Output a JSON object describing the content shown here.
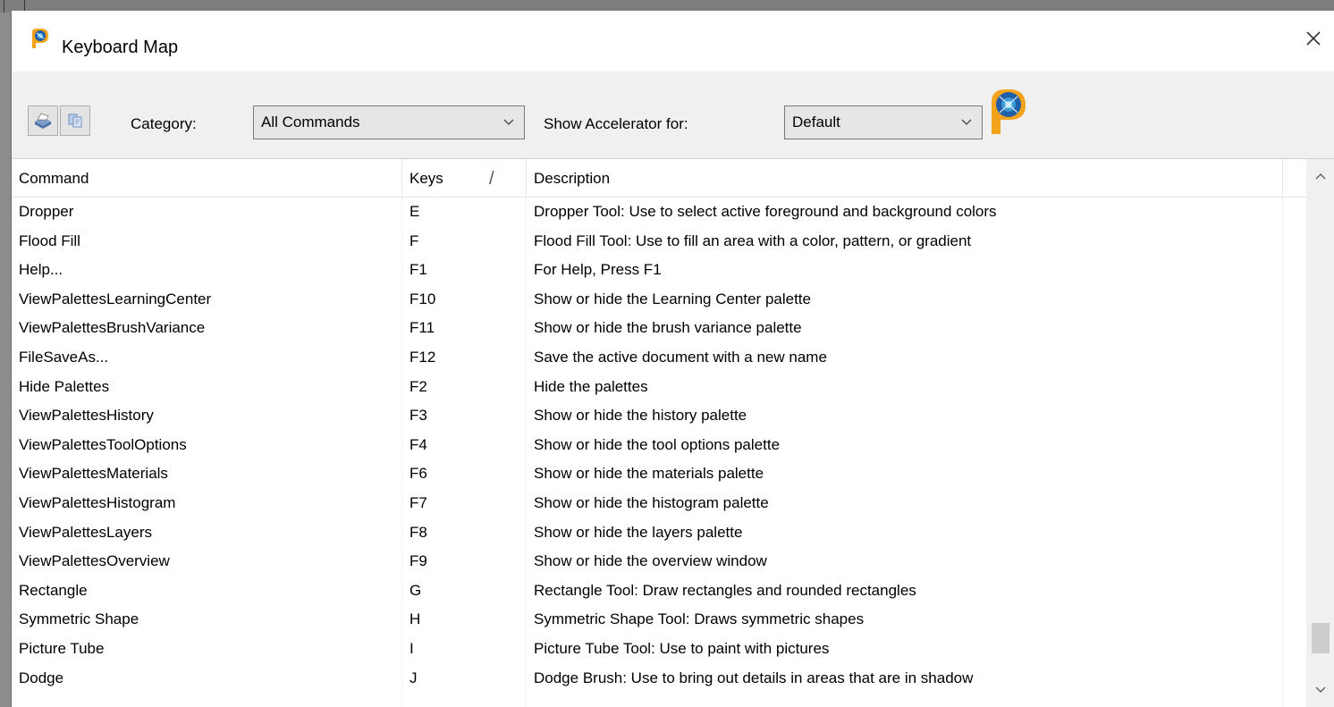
{
  "window": {
    "title": "Keyboard Map",
    "close_glyph": "✕"
  },
  "toolbar": {
    "category_label": "Category:",
    "category_value": "All Commands",
    "accelerator_label": "Show Accelerator for:",
    "accelerator_value": "Default",
    "icons": [
      "print-icon",
      "copy-icon",
      "app-logo-icon"
    ]
  },
  "table": {
    "columns": {
      "command": "Command",
      "keys": "Keys",
      "description": "Description"
    },
    "sort_indicator": "/",
    "rows": [
      {
        "command": "Dropper",
        "keys": "E",
        "description": "Dropper Tool: Use to select active foreground and background colors"
      },
      {
        "command": "Flood Fill",
        "keys": "F",
        "description": "Flood Fill Tool: Use to fill an area with a color, pattern, or gradient"
      },
      {
        "command": "Help...",
        "keys": "F1",
        "description": "For Help, Press F1"
      },
      {
        "command": "ViewPalettesLearningCenter",
        "keys": "F10",
        "description": "Show or hide the Learning Center palette"
      },
      {
        "command": "ViewPalettesBrushVariance",
        "keys": "F11",
        "description": "Show or hide the brush variance palette"
      },
      {
        "command": "FileSaveAs...",
        "keys": "F12",
        "description": "Save the active document with a new name"
      },
      {
        "command": "Hide Palettes",
        "keys": "F2",
        "description": "Hide the palettes"
      },
      {
        "command": "ViewPalettesHistory",
        "keys": "F3",
        "description": "Show or hide the history palette"
      },
      {
        "command": "ViewPalettesToolOptions",
        "keys": "F4",
        "description": "Show or hide the tool options palette"
      },
      {
        "command": "ViewPalettesMaterials",
        "keys": "F6",
        "description": "Show or hide the materials palette"
      },
      {
        "command": "ViewPalettesHistogram",
        "keys": "F7",
        "description": "Show or hide the histogram palette"
      },
      {
        "command": "ViewPalettesLayers",
        "keys": "F8",
        "description": "Show or hide the layers palette"
      },
      {
        "command": "ViewPalettesOverview",
        "keys": "F9",
        "description": "Show or hide the overview window"
      },
      {
        "command": "Rectangle",
        "keys": "G",
        "description": "Rectangle Tool: Draw rectangles and rounded rectangles"
      },
      {
        "command": "Symmetric Shape",
        "keys": "H",
        "description": "Symmetric Shape Tool: Draws symmetric shapes"
      },
      {
        "command": "Picture Tube",
        "keys": "I",
        "description": "Picture Tube Tool: Use to paint with pictures"
      },
      {
        "command": "Dodge",
        "keys": "J",
        "description": "Dodge Brush: Use to bring out details in areas that are in shadow"
      }
    ]
  },
  "scrollbar": {
    "up_glyph": "⌃",
    "down_glyph": "⌄"
  }
}
